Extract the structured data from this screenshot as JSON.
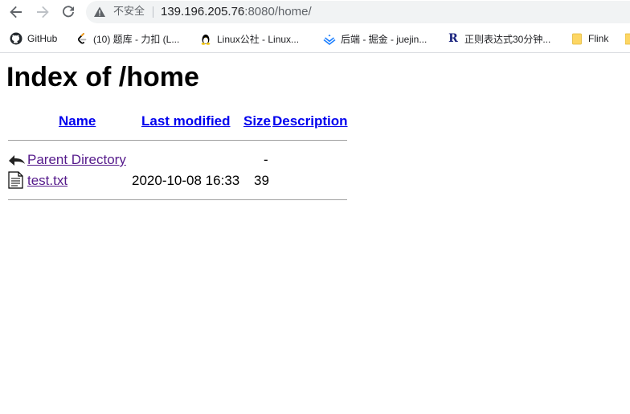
{
  "browser": {
    "security_label": "不安全",
    "url_host": "139.196.205.76",
    "url_rest": ":8080/home/"
  },
  "bookmarks": [
    {
      "label": "GitHub",
      "icon": "github-icon"
    },
    {
      "label": "(10) 题库 - 力扣 (L...",
      "icon": "leetcode-icon"
    },
    {
      "label": "Linux公社 - Linux...",
      "icon": "linux-penguin-icon"
    },
    {
      "label": "后端 - 掘金 - juejin...",
      "icon": "juejin-icon"
    },
    {
      "label": "正则表达式30分钟...",
      "icon": "regex-r-icon"
    },
    {
      "label": "Flink",
      "icon": "folder-icon"
    }
  ],
  "page": {
    "title": "Index of /home",
    "columns": {
      "name": "Name",
      "last_modified": "Last modified",
      "size": "Size",
      "description": "Description"
    },
    "rows": [
      {
        "name": "Parent Directory",
        "last_modified": "",
        "size": "-",
        "description": "",
        "icon": "back-arrow-icon"
      },
      {
        "name": "test.txt",
        "last_modified": "2020-10-08 16:33",
        "size": "39",
        "description": "",
        "icon": "text-file-icon"
      }
    ]
  },
  "colors": {
    "link": "#0000ee",
    "visited_link": "#551a8b",
    "omnibox_bg": "#f1f3f4"
  }
}
